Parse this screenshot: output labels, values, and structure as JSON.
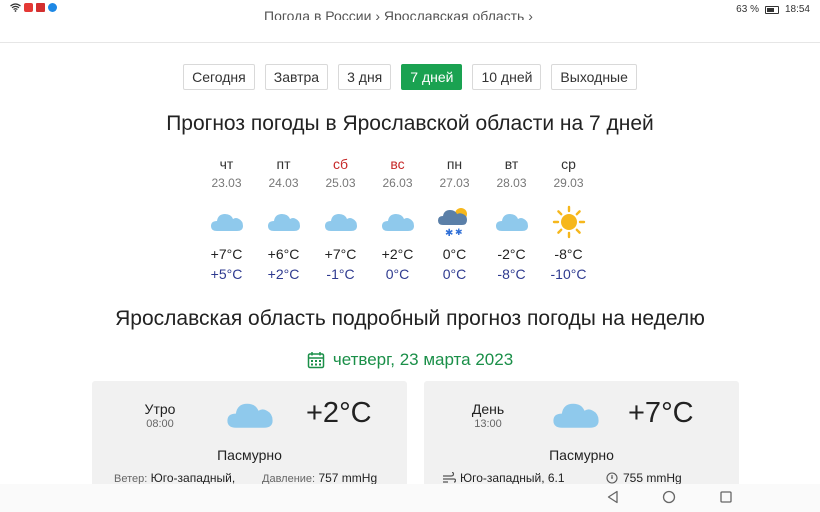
{
  "statusbar": {
    "battery": "63 %",
    "time": "18:54"
  },
  "breadcrumb": {
    "item1": "Погода в России",
    "sep": "›",
    "item2": "Ярославская область",
    "sep2": "›"
  },
  "tabs": [
    {
      "label": "Сегодня",
      "active": false
    },
    {
      "label": "Завтра",
      "active": false
    },
    {
      "label": "3 дня",
      "active": false
    },
    {
      "label": "7 дней",
      "active": true
    },
    {
      "label": "10 дней",
      "active": false
    },
    {
      "label": "Выходные",
      "active": false
    }
  ],
  "title": "Прогноз погоды в Ярославской области на 7 дней",
  "days": [
    {
      "name": "чт",
      "date": "23.03",
      "icon": "cloud-icon",
      "tmax": "+7°C",
      "tmin": "+5°C"
    },
    {
      "name": "пт",
      "date": "24.03",
      "icon": "cloud-icon",
      "tmax": "+6°C",
      "tmin": "+2°C"
    },
    {
      "name": "сб",
      "date": "25.03",
      "icon": "cloud-icon",
      "tmax": "+7°C",
      "tmin": "-1°C"
    },
    {
      "name": "вс",
      "date": "26.03",
      "icon": "cloud-icon",
      "tmax": "+2°C",
      "tmin": "0°C"
    },
    {
      "name": "пн",
      "date": "27.03",
      "icon": "snow-cloud-icon",
      "tmax": "0°C",
      "tmin": "0°C"
    },
    {
      "name": "вт",
      "date": "28.03",
      "icon": "cloud-icon",
      "tmax": "-2°C",
      "tmin": "-8°C"
    },
    {
      "name": "ср",
      "date": "29.03",
      "icon": "sun-icon",
      "tmax": "-8°C",
      "tmin": "-10°C"
    }
  ],
  "subtitle": "Ярославская область подробный прогноз погоды на неделю",
  "date_heading": "четверг, 23 марта 2023",
  "cards": [
    {
      "period": "Утро",
      "time": "08:00",
      "temp": "+2°C",
      "condition": "Пасмурно",
      "wind_label": "Ветер:",
      "wind": "Юго-западный,",
      "pressure_label": "Давление:",
      "pressure": "757 mmHg"
    },
    {
      "period": "День",
      "time": "13:00",
      "temp": "+7°C",
      "condition": "Пасмурно",
      "wind": "Юго-западный, 6.1",
      "pressure": "755 mmHg"
    }
  ],
  "colors": {
    "accent": "#1aa251",
    "weekend": "#c62828",
    "min_temp": "#2e3a8f",
    "cloud": "#8fc9ec",
    "sun": "#f6b71c"
  }
}
